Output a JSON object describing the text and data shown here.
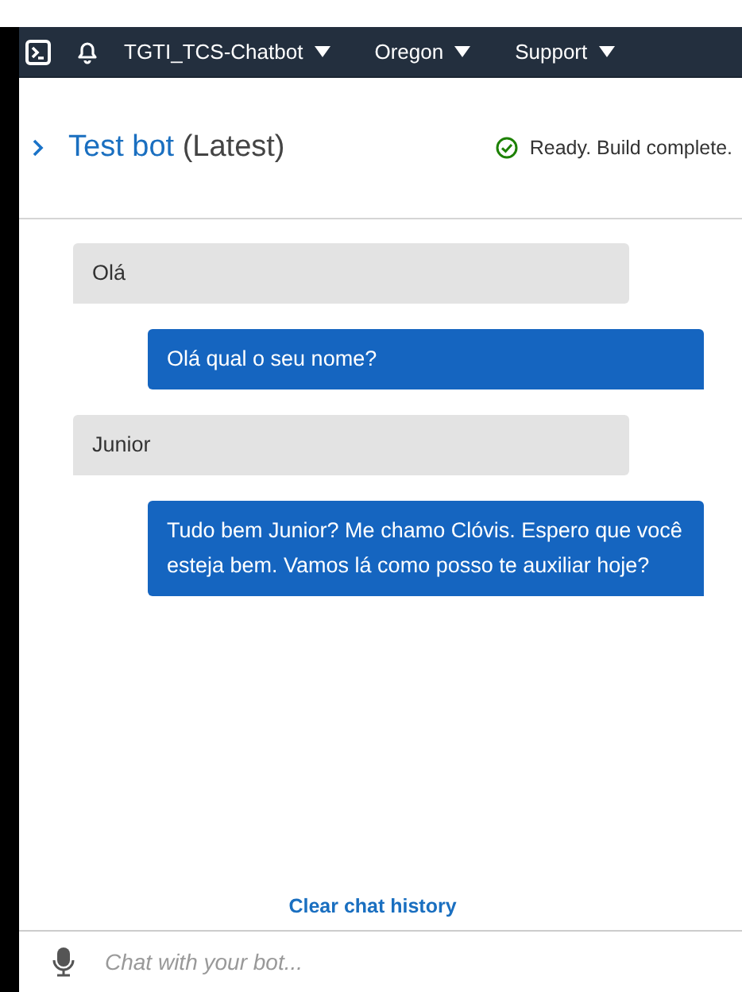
{
  "top_bar": {
    "items": [
      {
        "label": "TGTI_TCS-Chatbot"
      },
      {
        "label": "Oregon"
      },
      {
        "label": "Support"
      }
    ]
  },
  "panel": {
    "title": "Test bot",
    "version": "(Latest)",
    "status": "Ready. Build complete."
  },
  "messages": [
    {
      "kind": "user",
      "text": "Olá"
    },
    {
      "kind": "bot",
      "text": "Olá qual o seu nome?"
    },
    {
      "kind": "user",
      "text": "Junior"
    },
    {
      "kind": "bot",
      "text": "Tudo bem Junior? Me chamo Clóvis. Espero que você esteja bem. Vamos lá como posso te auxiliar hoje?"
    }
  ],
  "clear_link": "Clear chat history",
  "input": {
    "placeholder": "Chat with your bot..."
  }
}
